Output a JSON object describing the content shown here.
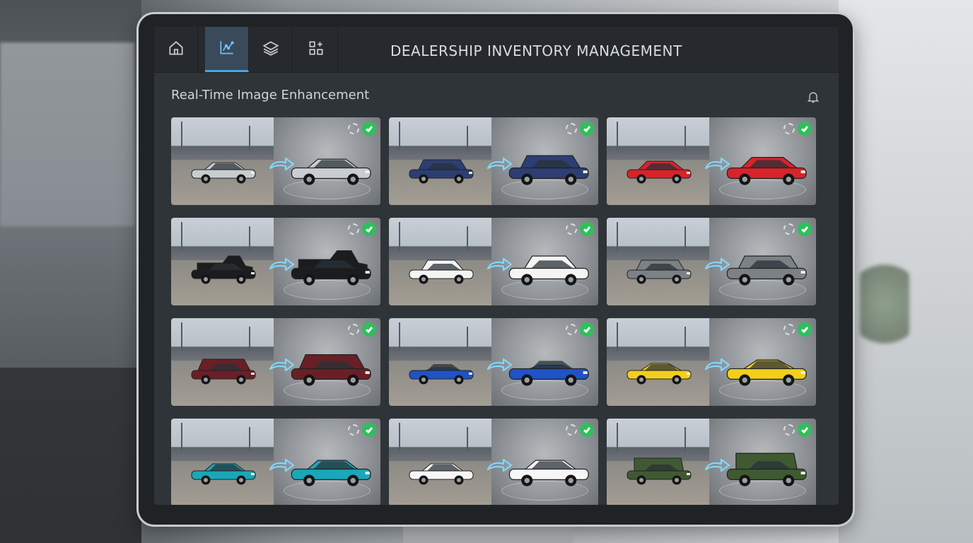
{
  "header": {
    "app_title": "DEALERSHIP INVENTORY MANAGEMENT",
    "section_title": "Real-Time Image Enhancement"
  },
  "nav": {
    "tabs": [
      {
        "icon": "home-icon",
        "active": false
      },
      {
        "icon": "analytics-icon",
        "active": true
      },
      {
        "icon": "layers-icon",
        "active": false
      },
      {
        "icon": "apps-add-icon",
        "active": false
      }
    ]
  },
  "colors": {
    "accent": "#4aa3e0",
    "arrow": "#7fd8ff",
    "check": "#2fbf5b"
  },
  "vehicles": [
    {
      "body": "sedan",
      "color": "#c9cdd1"
    },
    {
      "body": "suv",
      "color": "#2c3e73"
    },
    {
      "body": "hatchback",
      "color": "#d8232a"
    },
    {
      "body": "pickup",
      "color": "#1b1c1e"
    },
    {
      "body": "compact",
      "color": "#f4f4f2"
    },
    {
      "body": "suv",
      "color": "#7c8186"
    },
    {
      "body": "minivan",
      "color": "#6a1f26"
    },
    {
      "body": "convertible",
      "color": "#1f53c6"
    },
    {
      "body": "coupe",
      "color": "#f2cf1d"
    },
    {
      "body": "sedan",
      "color": "#1aa7b8"
    },
    {
      "body": "sedan",
      "color": "#f7f7f7"
    },
    {
      "body": "offroad",
      "color": "#3f5a32"
    }
  ]
}
